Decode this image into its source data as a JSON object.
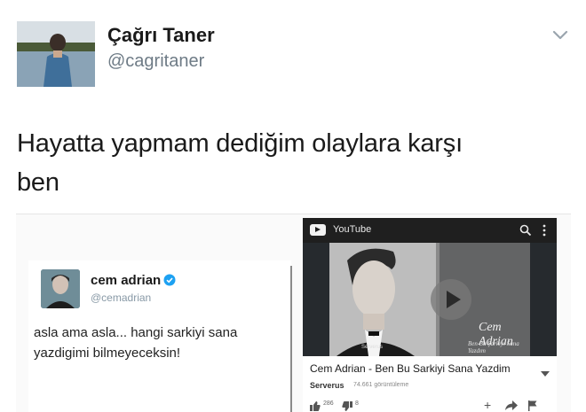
{
  "tweet": {
    "display_name": "Çağrı Taner",
    "handle": "@cagritaner",
    "text_line1": "Hayatta yapmam dediğim olaylara karşı",
    "text_line2": "ben"
  },
  "quoted_tweet": {
    "name": "cem adrian",
    "handle": "@cemadrian",
    "text_line1": "asla ama asla... hangi sarkiyi sana",
    "text_line2": "yazdigimi bilmeyeceksin!"
  },
  "youtube": {
    "app_title": "YouTube",
    "overlay_title": "Cem Adrian",
    "overlay_subtitle": "Ben Bu Şarkıyı Sana Yazdım",
    "overlay_channel": "Serverus",
    "video_title": "Cem Adrian - Ben Bu Sarkiyi Sana Yazdim",
    "channel": "Serverus",
    "views": "74.661 görüntüleme",
    "likes": "286",
    "dislikes": "8",
    "add_label": "+"
  },
  "colors": {
    "handle": "#6e7b86",
    "verified_blue": "#1da1f2",
    "yt_bar": "#1f1f1f"
  },
  "icons": [
    "chevron-down-icon",
    "verified-badge-icon",
    "youtube-logo-icon",
    "search-icon",
    "more-vertical-icon",
    "play-icon",
    "thumbs-up-icon",
    "thumbs-down-icon",
    "add-icon",
    "share-icon",
    "flag-icon"
  ]
}
